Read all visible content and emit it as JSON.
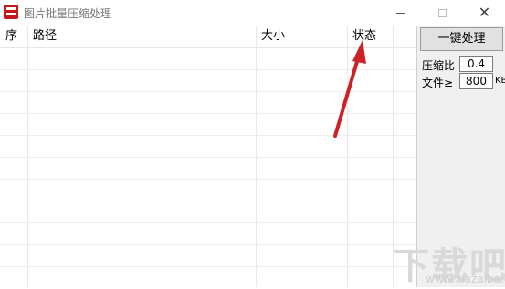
{
  "window": {
    "title": "图片批量压缩处理",
    "close_glyph": "✕"
  },
  "table": {
    "columns": [
      "序",
      "路径",
      "大小",
      "状态"
    ],
    "rows": []
  },
  "panel": {
    "action_button": "一键处理",
    "ratio_label": "压缩比",
    "ratio_value": "0.4",
    "filesize_label": "文件≥",
    "filesize_value": "800",
    "filesize_unit": "KB"
  },
  "watermark": {
    "text": "下载吧",
    "sub": "www.xiazaiba.com"
  },
  "colors": {
    "annotation_arrow": "#cc2127",
    "app_icon": "#c8161d"
  },
  "icons": [
    "app-logo-icon",
    "minimize-icon",
    "maximize-icon",
    "close-icon",
    "red-arrow-annotation"
  ]
}
